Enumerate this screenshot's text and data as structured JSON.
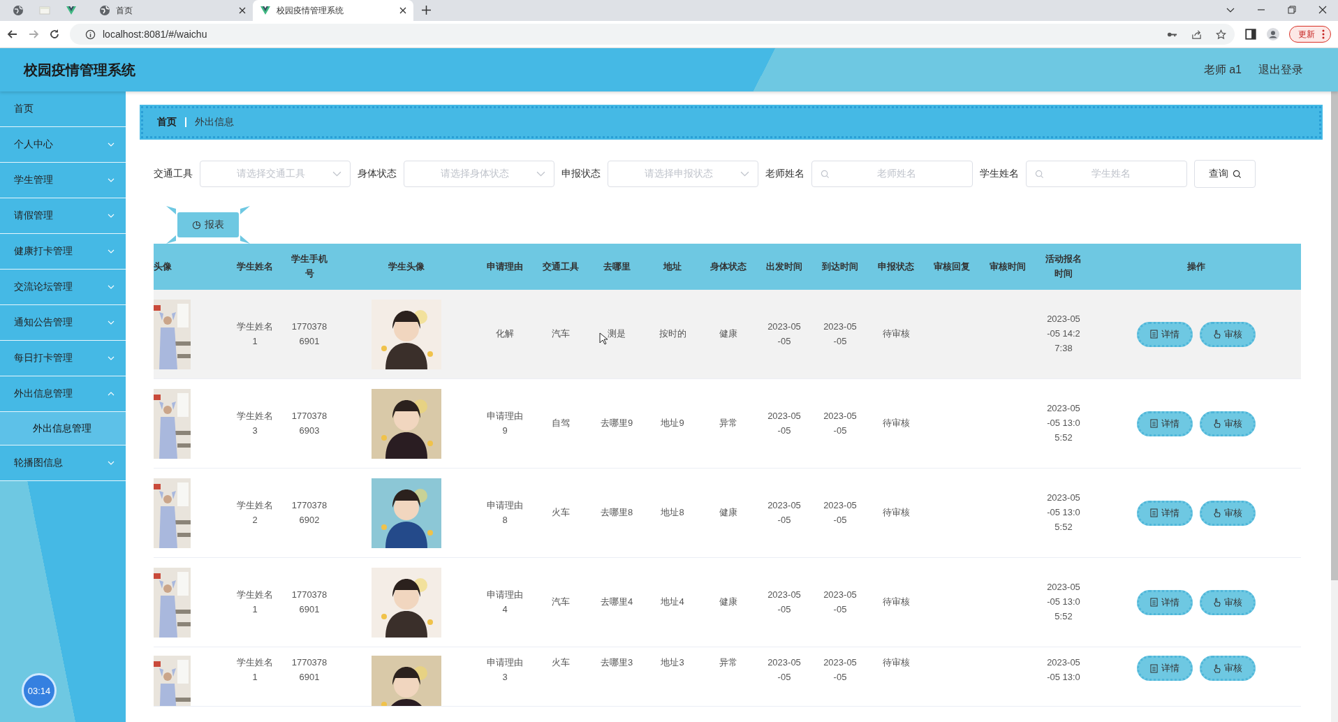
{
  "browser": {
    "tabs": [
      {
        "title": "首页",
        "selected": false
      },
      {
        "title": "校园疫情管理系统",
        "selected": true
      }
    ],
    "address": "localhost:8081/#/waichu",
    "update_button": "更新"
  },
  "header": {
    "title": "校园疫情管理系统",
    "user": "老师 a1",
    "logout": "退出登录"
  },
  "sidebar": {
    "items": [
      {
        "label": "首页",
        "kind": "link"
      },
      {
        "label": "个人中心",
        "kind": "menu",
        "expanded": false
      },
      {
        "label": "学生管理",
        "kind": "menu",
        "expanded": false
      },
      {
        "label": "请假管理",
        "kind": "menu",
        "expanded": false
      },
      {
        "label": "健康打卡管理",
        "kind": "menu",
        "expanded": false
      },
      {
        "label": "交流论坛管理",
        "kind": "menu",
        "expanded": false
      },
      {
        "label": "通知公告管理",
        "kind": "menu",
        "expanded": false
      },
      {
        "label": "每日打卡管理",
        "kind": "menu",
        "expanded": false
      },
      {
        "label": "外出信息管理",
        "kind": "menu",
        "expanded": true,
        "children": [
          {
            "label": "外出信息管理",
            "selected": true
          }
        ]
      },
      {
        "label": "轮播图信息",
        "kind": "menu",
        "expanded": false
      }
    ]
  },
  "timer": "03:14",
  "breadcrumb": [
    "首页",
    "外出信息"
  ],
  "filters": [
    {
      "label": "交通工具",
      "kind": "select",
      "placeholder": "请选择交通工具"
    },
    {
      "label": "身体状态",
      "kind": "select",
      "placeholder": "请选择身体状态"
    },
    {
      "label": "申报状态",
      "kind": "select",
      "placeholder": "请选择申报状态"
    },
    {
      "label": "老师姓名",
      "kind": "search",
      "placeholder": "老师姓名"
    },
    {
      "label": "学生姓名",
      "kind": "search",
      "placeholder": "学生姓名"
    }
  ],
  "query_button": "查询",
  "report_button": "报表",
  "table": {
    "columns": [
      "头像",
      "学生姓名",
      "学生手机号",
      "学生头像",
      "申请理由",
      "交通工具",
      "去哪里",
      "地址",
      "身体状态",
      "出发时间",
      "到达时间",
      "申报状态",
      "审核回复",
      "审核时间",
      "活动报名时间",
      "操作"
    ],
    "rows": [
      {
        "hovered": true,
        "name": "学生姓名1",
        "phone": "17703786901",
        "reason": "化解",
        "transport": "汽车",
        "destination": "测是",
        "address": "按时的",
        "health": "健康",
        "depart": "2023-05-05",
        "arrive": "2023-05-05",
        "status": "待审核",
        "signup_time": "2023-05-05 14:27:38",
        "actions": [
          "详情",
          "审核"
        ]
      },
      {
        "hovered": false,
        "name": "学生姓名3",
        "phone": "17703786903",
        "reason": "申请理由9",
        "transport": "自驾",
        "destination": "去哪里9",
        "address": "地址9",
        "health": "异常",
        "depart": "2023-05-05",
        "arrive": "2023-05-05",
        "status": "待审核",
        "signup_time": "2023-05-05 13:05:52",
        "actions": [
          "详情",
          "审核"
        ]
      },
      {
        "hovered": false,
        "name": "学生姓名2",
        "phone": "17703786902",
        "reason": "申请理由8",
        "transport": "火车",
        "destination": "去哪里8",
        "address": "地址8",
        "health": "健康",
        "depart": "2023-05-05",
        "arrive": "2023-05-05",
        "status": "待审核",
        "signup_time": "2023-05-05 13:05:52",
        "actions": [
          "详情",
          "审核"
        ]
      },
      {
        "hovered": false,
        "name": "学生姓名1",
        "phone": "17703786901",
        "reason": "申请理由4",
        "transport": "汽车",
        "destination": "去哪里4",
        "address": "地址4",
        "health": "健康",
        "depart": "2023-05-05",
        "arrive": "2023-05-05",
        "status": "待审核",
        "signup_time": "2023-05-05 13:05:52",
        "actions": [
          "详情",
          "审核"
        ]
      },
      {
        "hovered": false,
        "name": "学生姓名1",
        "phone": "17703786901",
        "reason": "申请理由3",
        "transport": "火车",
        "destination": "去哪里3",
        "address": "地址3",
        "health": "异常",
        "depart": "2023-05-05",
        "arrive": "2023-05-05",
        "status": "待审核",
        "signup_time": "2023-05-05 13:0",
        "actions": [
          "详情",
          "审核"
        ]
      }
    ]
  }
}
